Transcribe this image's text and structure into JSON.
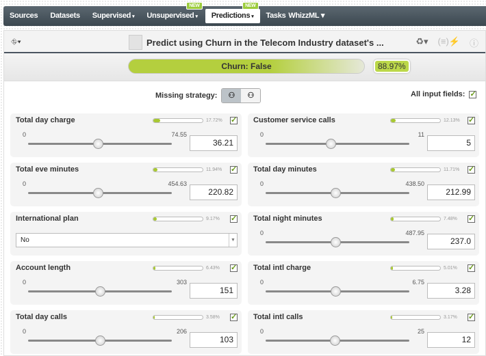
{
  "nav": {
    "items": [
      {
        "label": "Sources"
      },
      {
        "label": "Datasets"
      },
      {
        "label": "Supervised",
        "caret": "▾"
      },
      {
        "label": "Unsupervised",
        "caret": "▾",
        "badge": "NEW"
      },
      {
        "label": "Predictions",
        "caret": "▾",
        "badge": "NEW",
        "active": true
      },
      {
        "label": "Tasks"
      }
    ],
    "user": "WhizzML ▾"
  },
  "toolbar": {
    "title": "Predict using Churn in the Telecom Industry dataset's ...",
    "left_icon": "▾",
    "r1": "♻▾",
    "r2": "(≡)⚡",
    "r3": "ⓘ"
  },
  "result": {
    "label": "Churn: False",
    "confidence": "88.97%"
  },
  "options": {
    "missing_label": "Missing strategy:",
    "all_fields_label": "All input fields:"
  },
  "fields": [
    {
      "name": "Total day charge",
      "pct": "17.72%",
      "imp": 17.72,
      "min": "0",
      "max": "74.55",
      "maxv": 74.55,
      "value": "36.21"
    },
    {
      "name": "Customer service calls",
      "pct": "12.13%",
      "imp": 12.13,
      "min": "0",
      "max": "11",
      "maxv": 11,
      "value": "5"
    },
    {
      "name": "Total eve minutes",
      "pct": "11.94%",
      "imp": 11.94,
      "min": "0",
      "max": "454.63",
      "maxv": 454.63,
      "value": "220.82"
    },
    {
      "name": "Total day minutes",
      "pct": "11.71%",
      "imp": 11.71,
      "min": "0",
      "max": "438.50",
      "maxv": 438.5,
      "value": "212.99"
    },
    {
      "name": "International plan",
      "pct": "9.17%",
      "imp": 9.17,
      "select": "No"
    },
    {
      "name": "Total night minutes",
      "pct": "7.48%",
      "imp": 7.48,
      "min": "0",
      "max": "487.95",
      "maxv": 487.95,
      "value": "237.0"
    },
    {
      "name": "Account length",
      "pct": "6.43%",
      "imp": 6.43,
      "min": "0",
      "max": "303",
      "maxv": 303,
      "value": "151"
    },
    {
      "name": "Total intl charge",
      "pct": "5.01%",
      "imp": 5.01,
      "min": "0",
      "max": "6.75",
      "maxv": 6.75,
      "value": "3.28"
    },
    {
      "name": "Total day calls",
      "pct": "3.58%",
      "imp": 3.58,
      "min": "0",
      "max": "206",
      "maxv": 206,
      "value": "103"
    },
    {
      "name": "Total intl calls",
      "pct": "3.17%",
      "imp": 3.17,
      "min": "0",
      "max": "25",
      "maxv": 25,
      "value": "12"
    }
  ]
}
